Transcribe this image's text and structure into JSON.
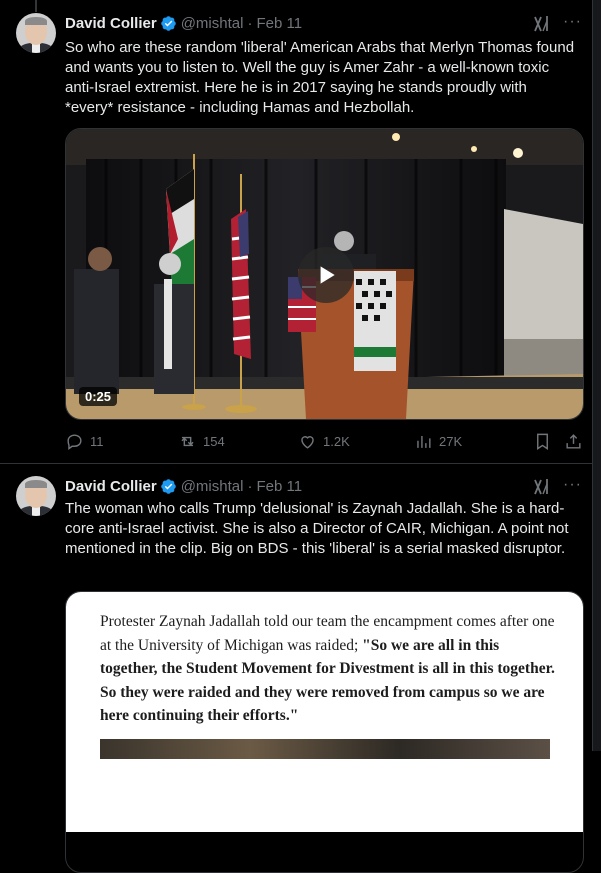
{
  "tweets": [
    {
      "author_name": "David Collier",
      "handle": "@mishtal",
      "separator": "·",
      "date": "Feb 11",
      "text": "So who are these random 'liberal' American Arabs that Merlyn Thomas found and wants you to listen to. Well the guy is Amer Zahr - a well-known toxic anti-Israel extremist. Here he is in 2017 saying he stands proudly with *every* resistance - including Hamas and Hezbollah.",
      "video": {
        "duration": "0:25"
      },
      "replies": "11",
      "reposts": "154",
      "likes": "1.2K",
      "views": "27K"
    },
    {
      "author_name": "David Collier",
      "handle": "@mishtal",
      "separator": "·",
      "date": "Feb 11",
      "text": "The woman who calls Trump 'delusional' is Zaynah Jadallah. She is a hard-core anti-Israel activist. She is also a Director of CAIR, Michigan. A point not mentioned in the clip.  Big on BDS - this 'liberal' is a serial masked disruptor.",
      "image_text": {
        "intro": "Protester Zaynah Jadallah told our team the encampment comes after one at the University of Michigan was raided; ",
        "quote": "\"So we are all in this together, the Student Movement for Divestment is all in this together. So they were raided and they were removed from campus so we are here continuing their efforts.\""
      }
    }
  ],
  "colors": {
    "background": "#000000",
    "text": "#e7e9ea",
    "secondary": "#71767b",
    "verified": "#1d9bf0",
    "border": "#2f3336"
  },
  "icons": [
    "verified-badge-icon",
    "grok-icon",
    "more-icon",
    "reply-icon",
    "repost-icon",
    "like-icon",
    "views-icon",
    "bookmark-icon",
    "share-icon",
    "play-icon"
  ]
}
